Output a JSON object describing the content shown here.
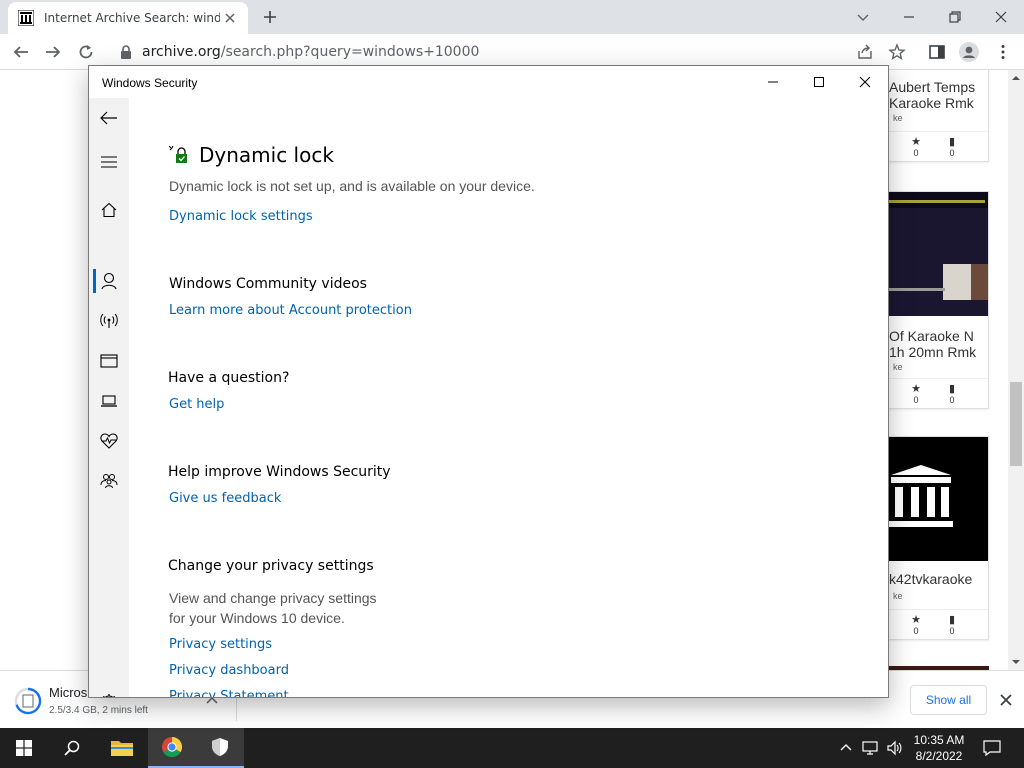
{
  "browser": {
    "tab_title": "Internet Archive Search: windows",
    "url_host": "archive.org",
    "url_path": "/search.php?query=windows+10000"
  },
  "page_cards": [
    {
      "title_line1": "Aubert Temps",
      "title_line2": "Karaoke Rmk",
      "sub": "ke",
      "favs": "0",
      "comments": "0"
    },
    {
      "title_line1": "Of Karaoke N",
      "title_line2": "1h 20mn Rmk",
      "sub": "ke",
      "favs": "0",
      "comments": "0"
    },
    {
      "title_line1": "k42tvkaraoke",
      "title_line2": "",
      "sub": "ke",
      "favs": "0",
      "comments": "0"
    }
  ],
  "download": {
    "name": "Micros",
    "status": "2.5/3.4 GB, 2 mins left",
    "show_all": "Show all"
  },
  "security_window": {
    "title": "Windows Security",
    "dynamic_lock": {
      "heading": "Dynamic lock",
      "description": "Dynamic lock is not set up, and is available on your device.",
      "link": "Dynamic lock settings"
    },
    "community": {
      "heading": "Windows Community videos",
      "link": "Learn more about Account protection"
    },
    "question": {
      "heading": "Have a question?",
      "link": "Get help"
    },
    "improve": {
      "heading": "Help improve Windows Security",
      "link": "Give us feedback"
    },
    "privacy": {
      "heading": "Change your privacy settings",
      "description_line1": "View and change privacy settings",
      "description_line2": "for your Windows 10 device.",
      "link_settings": "Privacy settings",
      "link_dashboard": "Privacy dashboard",
      "link_statement": "Privacy Statement"
    }
  },
  "taskbar": {
    "time": "10:35 AM",
    "date": "8/2/2022"
  },
  "colors": {
    "link": "#0063b1",
    "accent": "#0067c0",
    "taskbar": "#1f1f1f"
  }
}
